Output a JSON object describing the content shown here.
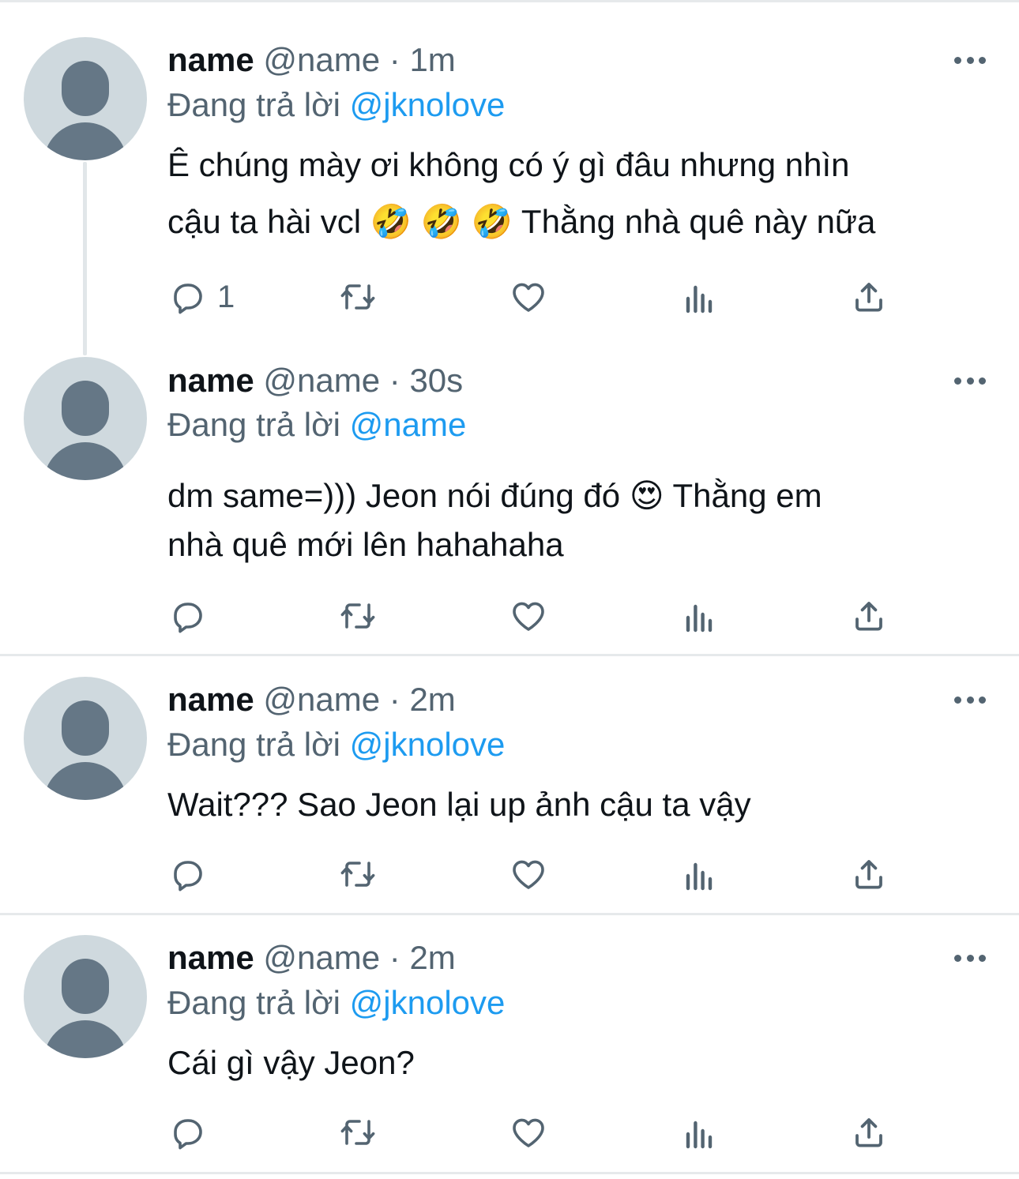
{
  "tweets": [
    {
      "name": "name",
      "handle": "@name",
      "separator": "·",
      "time": "1m",
      "replying_prefix": "Đang trả lời",
      "replying_to": "@jknolove",
      "line1": "Ê chúng mày ơi không có ý gì đâu nhưng nhìn",
      "line2": "cậu ta hài vcl 🤣 🤣 🤣  Thằng nhà quê này nữa",
      "reply_count": "1"
    },
    {
      "name": "name",
      "handle": "@name",
      "separator": "·",
      "time": "30s",
      "replying_prefix": "Đang trả lời",
      "replying_to": "@name",
      "line1": "dm same=))) Jeon nói đúng đó 😍  Thằng em",
      "line2": "nhà quê mới lên hahahaha",
      "reply_count": ""
    },
    {
      "name": "name",
      "handle": "@name",
      "separator": "·",
      "time": "2m",
      "replying_prefix": "Đang trả lời",
      "replying_to": "@jknolove",
      "line1": "Wait??? Sao Jeon lại up ảnh cậu ta vậy",
      "reply_count": ""
    },
    {
      "name": "name",
      "handle": "@name",
      "separator": "·",
      "time": "2m",
      "replying_prefix": "Đang trả lời",
      "replying_to": "@jknolove",
      "line1": "Cái gì vậy Jeon?",
      "reply_count": ""
    }
  ],
  "colors": {
    "text": "#0f1419",
    "secondary": "#536471",
    "link": "#1d9bf0",
    "avatar_bg": "#cfd9de",
    "avatar_fg": "#657786",
    "divider": "#e6e9eb"
  },
  "icons": [
    "reply-icon",
    "retweet-icon",
    "like-icon",
    "views-icon",
    "share-icon",
    "more-icon"
  ]
}
